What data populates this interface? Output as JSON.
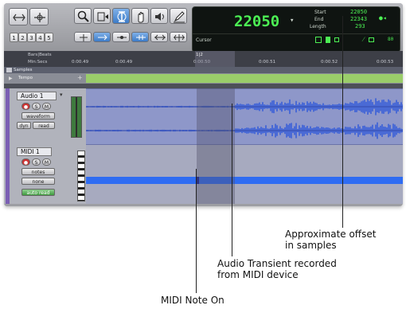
{
  "toolbar": {
    "nums": [
      "1",
      "2",
      "3",
      "4",
      "5"
    ]
  },
  "counter": {
    "main": "22050",
    "start_label": "Start",
    "end_label": "End",
    "length_label": "Length",
    "start": "22050",
    "end": "22343",
    "length": "293",
    "cursor_label": "Cursor",
    "nudge": "80"
  },
  "ruler": {
    "row1": "Bars|Beats",
    "row2": "Min:Secs",
    "samples": "Samples",
    "ticks": [
      "0:00.49",
      "0:00.49",
      "0:00.50",
      "0:00.51",
      "0:00.52",
      "0:00.53"
    ],
    "marker": "1|2",
    "tempo": "Tempo"
  },
  "audio_track": {
    "name": "Audio 1",
    "view": "waveform",
    "dyn": "dyn",
    "read": "read"
  },
  "midi_track": {
    "name": "MIDI 1",
    "view": "notes",
    "none": "none",
    "auto": "auto read"
  },
  "annotations": {
    "offset": [
      "Approximate offset",
      "in samples"
    ],
    "transient": [
      "Audio Transient recorded",
      "from MIDI device"
    ],
    "note_on": "MIDI Note On"
  },
  "colors": {
    "counter_green": "#4cf054",
    "waveform_blue": "#3a5fd8",
    "midi_note_blue": "#2f6cf2",
    "selection_overlay": "#6f7090"
  }
}
